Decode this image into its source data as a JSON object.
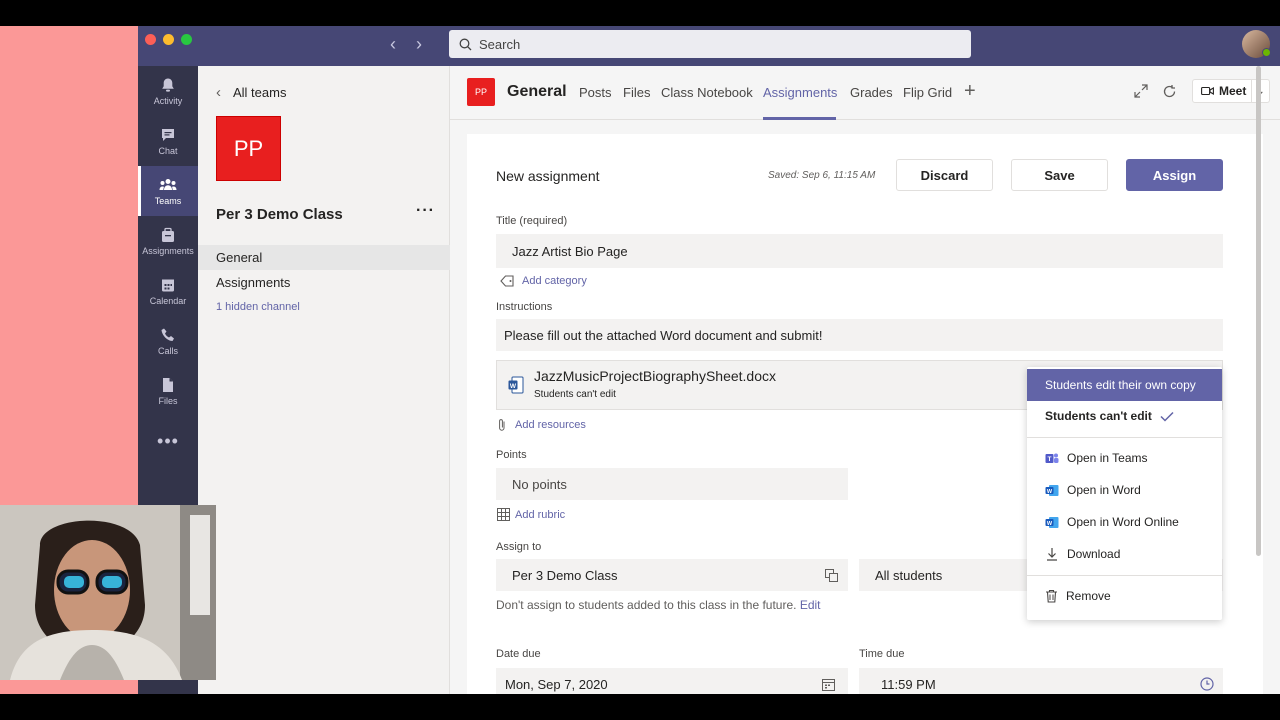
{
  "search": {
    "placeholder": "Search"
  },
  "rail": [
    {
      "label": "Activity",
      "icon": "bell-icon"
    },
    {
      "label": "Chat",
      "icon": "chat-icon"
    },
    {
      "label": "Teams",
      "icon": "teams-icon"
    },
    {
      "label": "Assignments",
      "icon": "assignments-icon"
    },
    {
      "label": "Calendar",
      "icon": "calendar-icon"
    },
    {
      "label": "Calls",
      "icon": "phone-icon"
    },
    {
      "label": "Files",
      "icon": "file-icon"
    }
  ],
  "rail_more": "•••",
  "team_panel": {
    "back_label": "All teams",
    "tile_initials": "PP",
    "team_name": "Per 3 Demo Class",
    "more": "···",
    "channels": [
      "General",
      "Assignments",
      "1 hidden channel"
    ]
  },
  "channel_header": {
    "tile_initials": "PP",
    "name": "General",
    "tabs": [
      "Posts",
      "Files",
      "Class Notebook",
      "Assignments",
      "Grades",
      "Flip Grid"
    ],
    "active_tab": "Assignments",
    "meet_label": "Meet"
  },
  "assignment": {
    "heading": "New assignment",
    "saved": "Saved: Sep 6, 11:15 AM",
    "discard": "Discard",
    "save": "Save",
    "assign": "Assign",
    "title_label": "Title (required)",
    "title_value": "Jazz Artist Bio Page",
    "add_category": "Add category",
    "instructions_label": "Instructions",
    "instructions_value": "Please fill out the attached Word document and submit!",
    "attachment": {
      "file_name": "JazzMusicProjectBiographySheet.docx",
      "permission": "Students can't edit",
      "more": "•••"
    },
    "add_resources": "Add resources",
    "points_label": "Points",
    "points_value": "No points",
    "add_rubric": "Add rubric",
    "assign_to_label": "Assign to",
    "class_value": "Per 3 Demo Class",
    "students_value": "All students",
    "future_note": "Don't assign to students added to this class in the future.",
    "edit_link": "Edit",
    "date_due_label": "Date due",
    "date_due_value": "Mon, Sep 7, 2020",
    "time_due_label": "Time due",
    "time_due_value": "11:59 PM"
  },
  "context_menu": {
    "items": [
      {
        "label": "Students edit their own copy",
        "state": "hover"
      },
      {
        "label": "Students can't edit",
        "state": "checked"
      },
      {
        "label": "Open in Teams",
        "icon": "teams-icon"
      },
      {
        "label": "Open in Word",
        "icon": "word-icon"
      },
      {
        "label": "Open in Word Online",
        "icon": "word-icon"
      },
      {
        "label": "Download",
        "icon": "download-icon"
      },
      {
        "label": "Remove",
        "icon": "trash-icon"
      }
    ]
  },
  "colors": {
    "accent": "#6264a7",
    "titlebar": "#464775",
    "rail": "#33344a",
    "team_tile": "#e81f1f",
    "page_bg_left": "#fb9897"
  }
}
